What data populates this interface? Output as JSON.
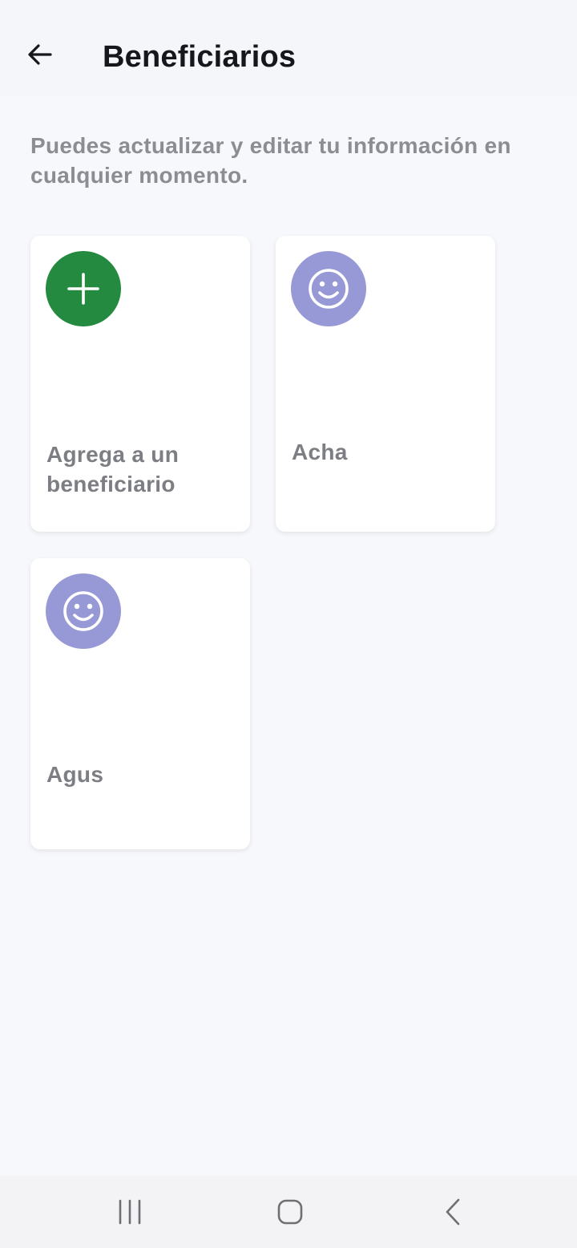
{
  "header": {
    "title": "Beneficiarios",
    "back_icon": "arrow-left-icon"
  },
  "intro_text": "Puedes actualizar y editar tu información en cualquier momento.",
  "add_card": {
    "label": "Agrega a un beneficiario",
    "icon": "plus-icon",
    "icon_bg": "#238a3f"
  },
  "beneficiaries": [
    {
      "name": "Acha",
      "icon": "smiley-face-icon",
      "icon_bg": "#9799d6"
    },
    {
      "name": "Agus",
      "icon": "smiley-face-icon",
      "icon_bg": "#9799d6"
    }
  ],
  "system_nav": {
    "recents_icon": "recents-icon",
    "home_icon": "home-icon",
    "back_icon": "back-chevron-icon"
  }
}
